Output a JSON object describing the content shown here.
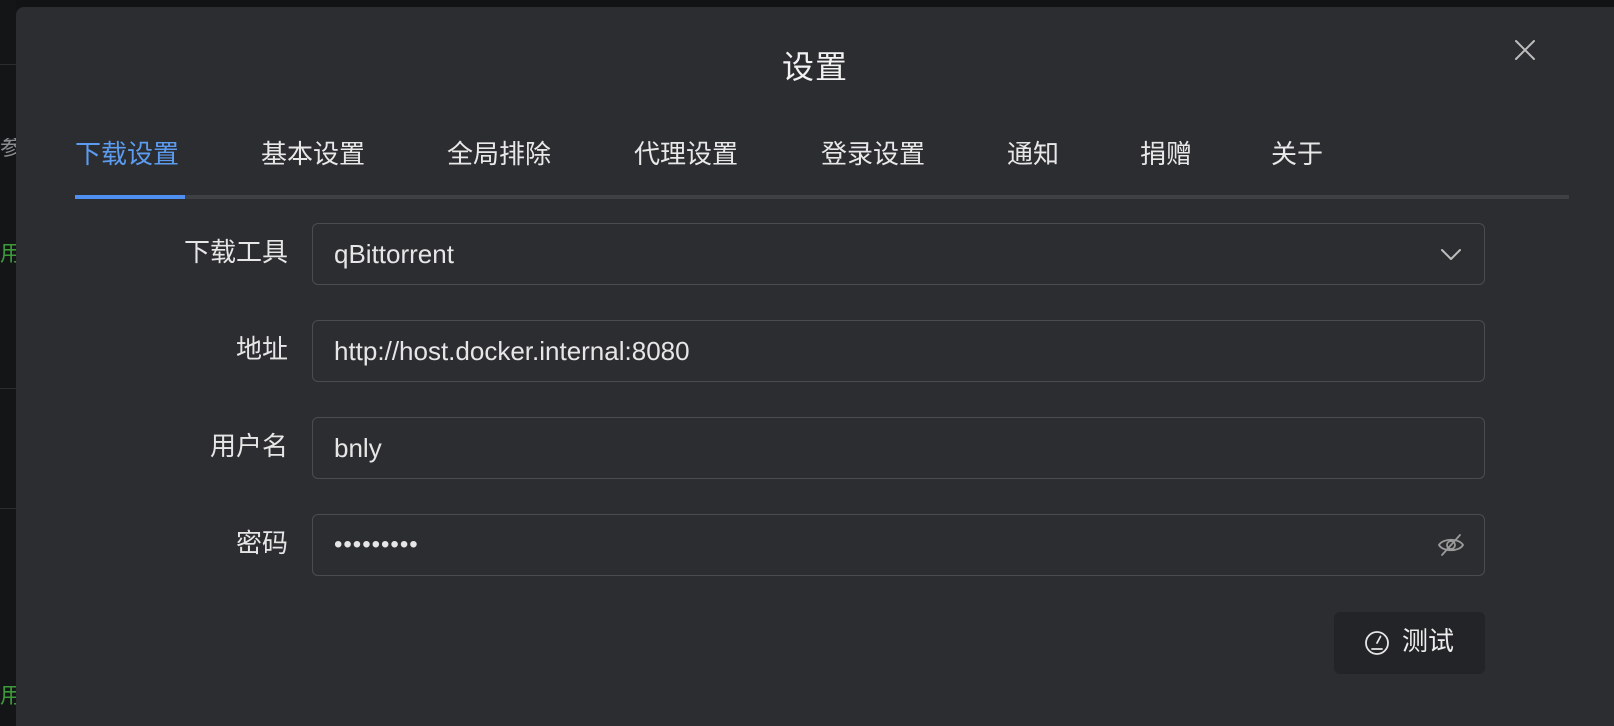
{
  "background": {
    "side_texts": [
      "参",
      "用",
      "用"
    ]
  },
  "modal": {
    "title": "设置"
  },
  "tabs": [
    {
      "label": "下载设置",
      "active": true
    },
    {
      "label": "基本设置",
      "active": false
    },
    {
      "label": "全局排除",
      "active": false
    },
    {
      "label": "代理设置",
      "active": false
    },
    {
      "label": "登录设置",
      "active": false
    },
    {
      "label": "通知",
      "active": false
    },
    {
      "label": "捐赠",
      "active": false
    },
    {
      "label": "关于",
      "active": false
    }
  ],
  "form": {
    "downloader": {
      "label": "下载工具",
      "value": "qBittorrent"
    },
    "address": {
      "label": "地址",
      "value": "http://host.docker.internal:8080"
    },
    "username": {
      "label": "用户名",
      "value": "bnly"
    },
    "password": {
      "label": "密码",
      "value": "•••••••••"
    }
  },
  "actions": {
    "test_label": "测试"
  },
  "colors": {
    "accent": "#4f8ff0",
    "modal_bg": "#2c2d30",
    "field_border": "#4a4c50"
  },
  "icons": {
    "close": "close-icon",
    "select": "chevron-down-icon",
    "password_toggle": "eye-off-icon",
    "test": "gauge-icon"
  }
}
